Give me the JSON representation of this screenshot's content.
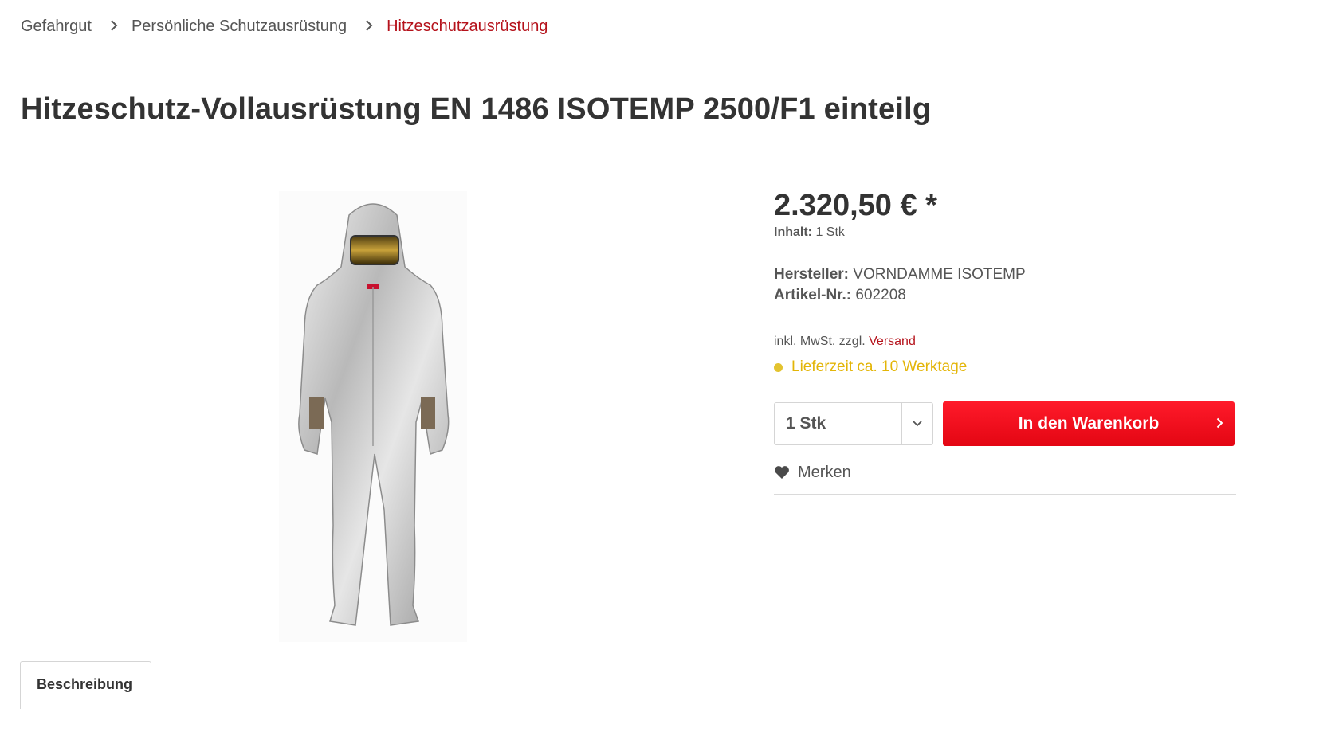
{
  "breadcrumb": {
    "items": [
      "Gefahrgut",
      "Persönliche Schutzausrüstung",
      "Hitzeschutzausrüstung"
    ]
  },
  "product": {
    "title": "Hitzeschutz-Vollausrüstung EN 1486 ISOTEMP 2500/F1 einteilg",
    "price": "2.320,50 € *",
    "content_label": "Inhalt:",
    "content_value": "1 Stk",
    "manufacturer_label": "Hersteller:",
    "manufacturer_value": "VORNDAMME ISOTEMP",
    "article_label": "Artikel-Nr.:",
    "article_value": "602208",
    "tax_text": "inkl. MwSt. zzgl.",
    "shipping_link": "Versand",
    "delivery": "Lieferzeit ca. 10 Werktage"
  },
  "cart": {
    "quantity": "1 Stk",
    "button_label": "In den Warenkorb",
    "note_label": "Merken"
  },
  "tabs": {
    "description": "Beschreibung"
  },
  "colors": {
    "accent": "#b5121b",
    "cart_button": "#e30613",
    "delivery": "#e3b508"
  }
}
